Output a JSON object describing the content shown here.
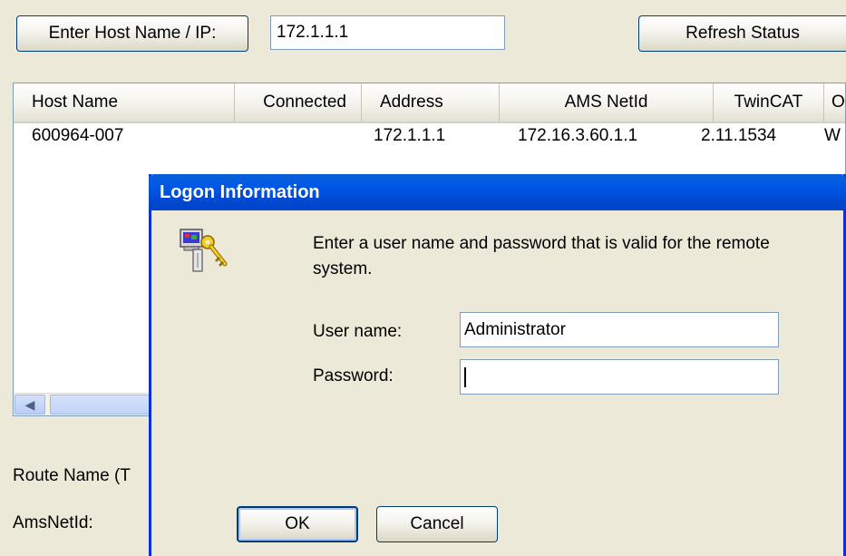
{
  "toolbar": {
    "enter_host_label": "Enter Host Name / IP:",
    "host_value": "172.1.1.1",
    "refresh_label": "Refresh Status"
  },
  "table": {
    "columns": [
      "Host Name",
      "Connected",
      "Address",
      "AMS NetId",
      "TwinCAT",
      "O"
    ],
    "rows": [
      [
        "600964-007",
        "",
        "172.1.1.1",
        "172.16.3.60.1.1",
        "2.11.1534",
        "W"
      ]
    ]
  },
  "bottom": {
    "route_name_label": "Route Name (T",
    "amsnetid_label": "AmsNetId:"
  },
  "dialog": {
    "title": "Logon Information",
    "message": "Enter a user name and password that is valid for the remote system.",
    "username_label": "User name:",
    "username_value": "Administrator",
    "password_label": "Password:",
    "password_value": "",
    "ok_label": "OK",
    "cancel_label": "Cancel",
    "icon": "key-login-icon"
  },
  "colors": {
    "window_bg": "#ece9d8",
    "titlebar_blue": "#0058e6",
    "field_border": "#7f9db9"
  }
}
